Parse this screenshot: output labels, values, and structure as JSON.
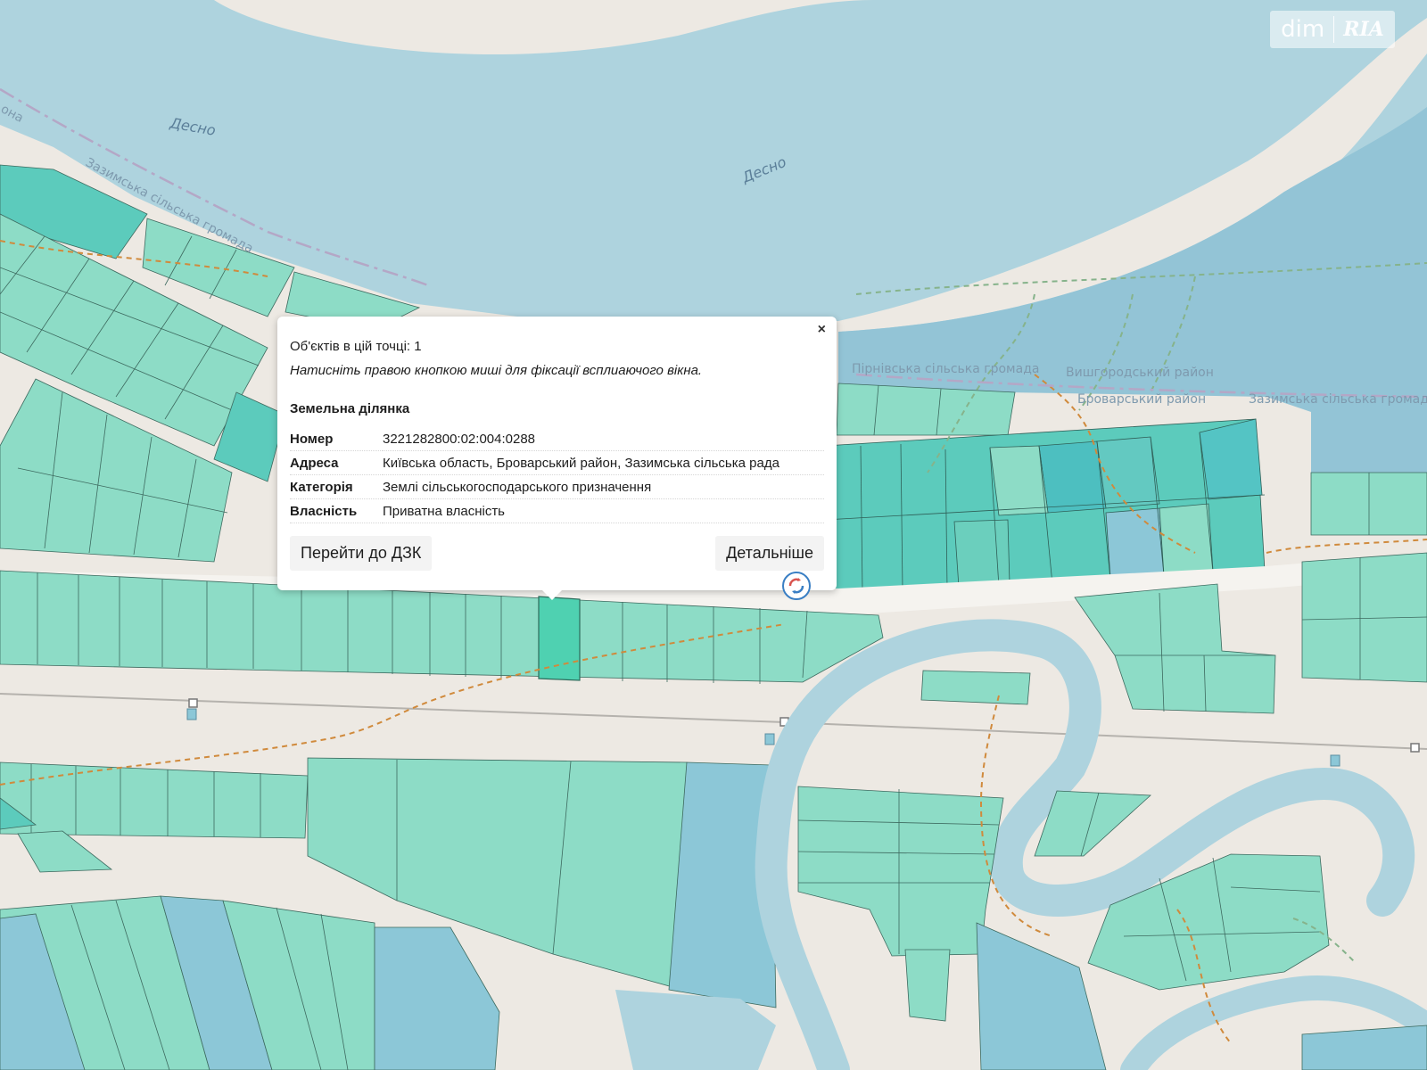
{
  "map": {
    "labels": {
      "river_top_left": "Десно",
      "river_top_center": "Десно",
      "boundary_zazymska_top": "Зазимська сільська громада",
      "boundary_edge_top_left": "она",
      "boundary_pirnivska": "Пірнівська сільська громада",
      "boundary_vyshhorodskyi": "Вишгородський район",
      "boundary_brovarskyi": "Броварський район",
      "boundary_zazymska_right": "Зазимська сільська громад"
    },
    "colors": {
      "water": "#aed3de",
      "land": "#ede9e3",
      "parcel": "#8ddcc6",
      "parcel_teal": "#5ccbbc",
      "parcel_blue": "#8cc7d7",
      "parcel_selected": "#4fd1b1",
      "road": "#f5f3ef",
      "trail": "#d08a3c"
    }
  },
  "watermark": {
    "left": "dim",
    "right": "RIA"
  },
  "popup": {
    "close_symbol": "×",
    "objects_count": "Об'єктів в цій точці: 1",
    "hint": "Натисніть правою кнопкою миші для фіксації всплиаючого вікна.",
    "heading": "Земельна ділянка",
    "rows": [
      {
        "key": "Номер",
        "value": "3221282800:02:004:0288"
      },
      {
        "key": "Адреса",
        "value": "Київська область, Броварський район, Зазимська сільська рада"
      },
      {
        "key": "Категорія",
        "value": "Землі сільськогосподарського призначення"
      },
      {
        "key": "Власність",
        "value": "Приватна власність"
      }
    ],
    "button_left": "Перейти до ДЗК",
    "button_right": "Детальніше"
  }
}
